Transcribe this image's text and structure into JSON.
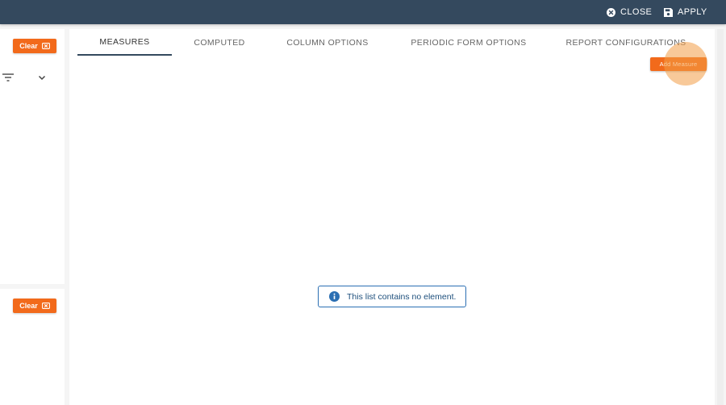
{
  "topbar": {
    "close_label": "CLOSE",
    "apply_label": "APPLY",
    "close_icon": "close-circle-icon",
    "apply_icon": "save-icon",
    "background": "#34495e"
  },
  "left_panel": {
    "clear_label": "Clear",
    "clear_icon": "clear-x-box-icon",
    "filter_icon": "filter-icon",
    "expand_icon": "chevron-down-icon",
    "accent": "#f26a1b"
  },
  "tabs": [
    {
      "label": "MEASURES",
      "active": true
    },
    {
      "label": "COMPUTED",
      "active": false
    },
    {
      "label": "COLUMN OPTIONS",
      "active": false
    },
    {
      "label": "PERIODIC FORM OPTIONS",
      "active": false
    },
    {
      "label": "REPORT CONFIGURATIONS",
      "active": false
    }
  ],
  "add_measure_label": "Add Measure",
  "empty_state": {
    "message": "This list contains no element.",
    "icon": "info-icon",
    "color": "#2b6fb3"
  }
}
